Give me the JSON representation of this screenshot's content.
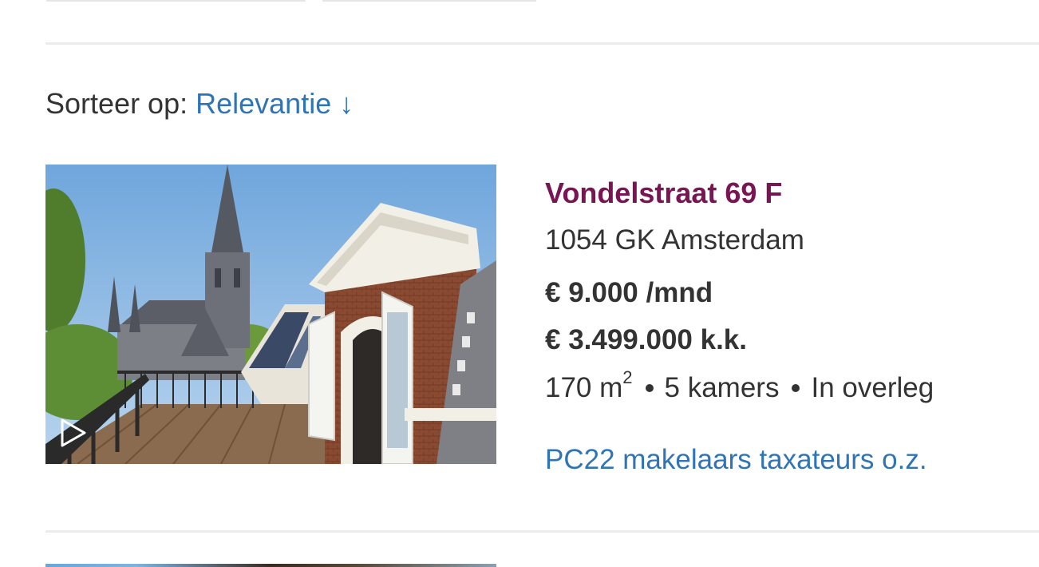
{
  "sort": {
    "label": "Sorteer op:",
    "value": "Relevantie ↓"
  },
  "listing": {
    "title": "Vondelstraat 69 F",
    "address": "1054 GK Amsterdam",
    "price_rent": "€ 9.000 /mnd",
    "price_sale": "€ 3.499.000 k.k.",
    "area": "170 m",
    "area_unit_sup": "2",
    "rooms": "5 kamers",
    "availability": "In overleg",
    "agent": "PC22 makelaars taxateurs o.z.",
    "photo_icon": "play-icon"
  },
  "colors": {
    "title": "#7a1553",
    "link": "#2f74b5",
    "text": "#333333",
    "divider": "#ececec"
  }
}
